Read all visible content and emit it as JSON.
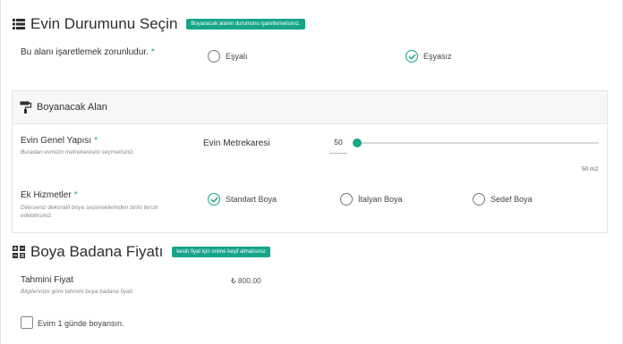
{
  "section1": {
    "title": "Evin Durumunu Seçin",
    "badge": "Boyanacak alanın durumunu işaretlemelisiniz.",
    "question": "Bu alanı işaretlemek zorunludur.",
    "required_mark": "*",
    "options": [
      {
        "label": "Eşyalı",
        "selected": false
      },
      {
        "label": "Eşyasız",
        "selected": true
      }
    ]
  },
  "panel": {
    "title": "Boyanacak Alan",
    "general": {
      "label": "Evin Genel Yapısı",
      "required_mark": "*",
      "hint": "Buradan evinizin metrekaresini seçmelisiniz.",
      "slider_label": "Evin Metrekaresi",
      "value": "50",
      "max_label": "50 m2",
      "fill_fraction": 0
    },
    "extras": {
      "label": "Ek Hizmetler",
      "required_mark": "*",
      "hint_line1": "Dilerseniz dekoratif boya seçeneklerinden birini tercih",
      "hint_line2": "edebilirsiniz.",
      "options": [
        {
          "label": "Standart Boya",
          "selected": true
        },
        {
          "label": "İtalyan Boya",
          "selected": false
        },
        {
          "label": "Sedef Boya",
          "selected": false
        }
      ]
    }
  },
  "section2": {
    "title": "Boya Badana Fiyatı",
    "badge": "kesin fiyat için online keşif almalısınız",
    "price_label": "Tahmini Fiyat",
    "price_hint": "Bilgilerinize göre tahmini boya badana fiyatı",
    "price_value": "₺ 800.00",
    "checkbox_label": "Evim 1 günde boyansın.",
    "checkbox_checked": false
  },
  "colors": {
    "accent": "#17a589",
    "text": "#333333",
    "muted": "#888888"
  },
  "icons": {
    "section1": "list-icon",
    "panel": "paint-roller-icon",
    "section2": "calculator-icon",
    "radio_checked": "check-circle-icon"
  }
}
